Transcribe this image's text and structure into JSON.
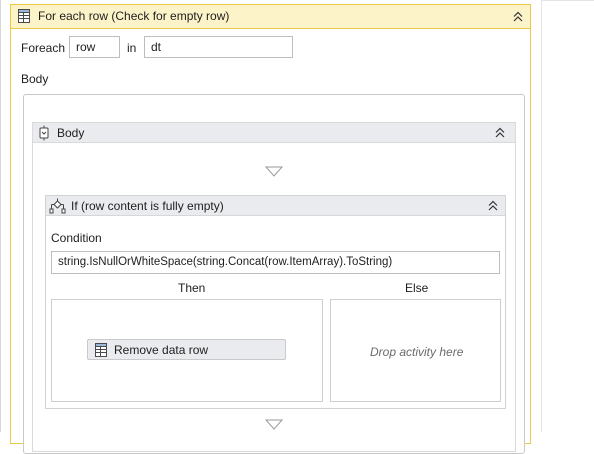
{
  "foreach": {
    "title": "For each row (Check for empty row)",
    "foreach_label": "Foreach",
    "item_value": "row",
    "in_label": "in",
    "collection_value": "dt",
    "body_label": "Body"
  },
  "sequence": {
    "title": "Body"
  },
  "if_activity": {
    "title": "If (row content is fully empty)",
    "condition_label": "Condition",
    "condition_value": "string.IsNullOrWhiteSpace(string.Concat(row.ItemArray).ToString)",
    "then_label": "Then",
    "else_label": "Else",
    "then_activity": "Remove data row",
    "else_placeholder": "Drop activity here"
  },
  "colors": {
    "foreach_header": "#fdf3c8",
    "foreach_border": "#e8c94a",
    "activity_header": "#e9ebee"
  },
  "icons": {
    "foreach": "datatable-icon",
    "sequence": "sequence-icon",
    "if": "if-icon",
    "remove": "datatable-icon",
    "collapse": "double-chevron-up-icon",
    "drop": "triangle-down-icon"
  }
}
